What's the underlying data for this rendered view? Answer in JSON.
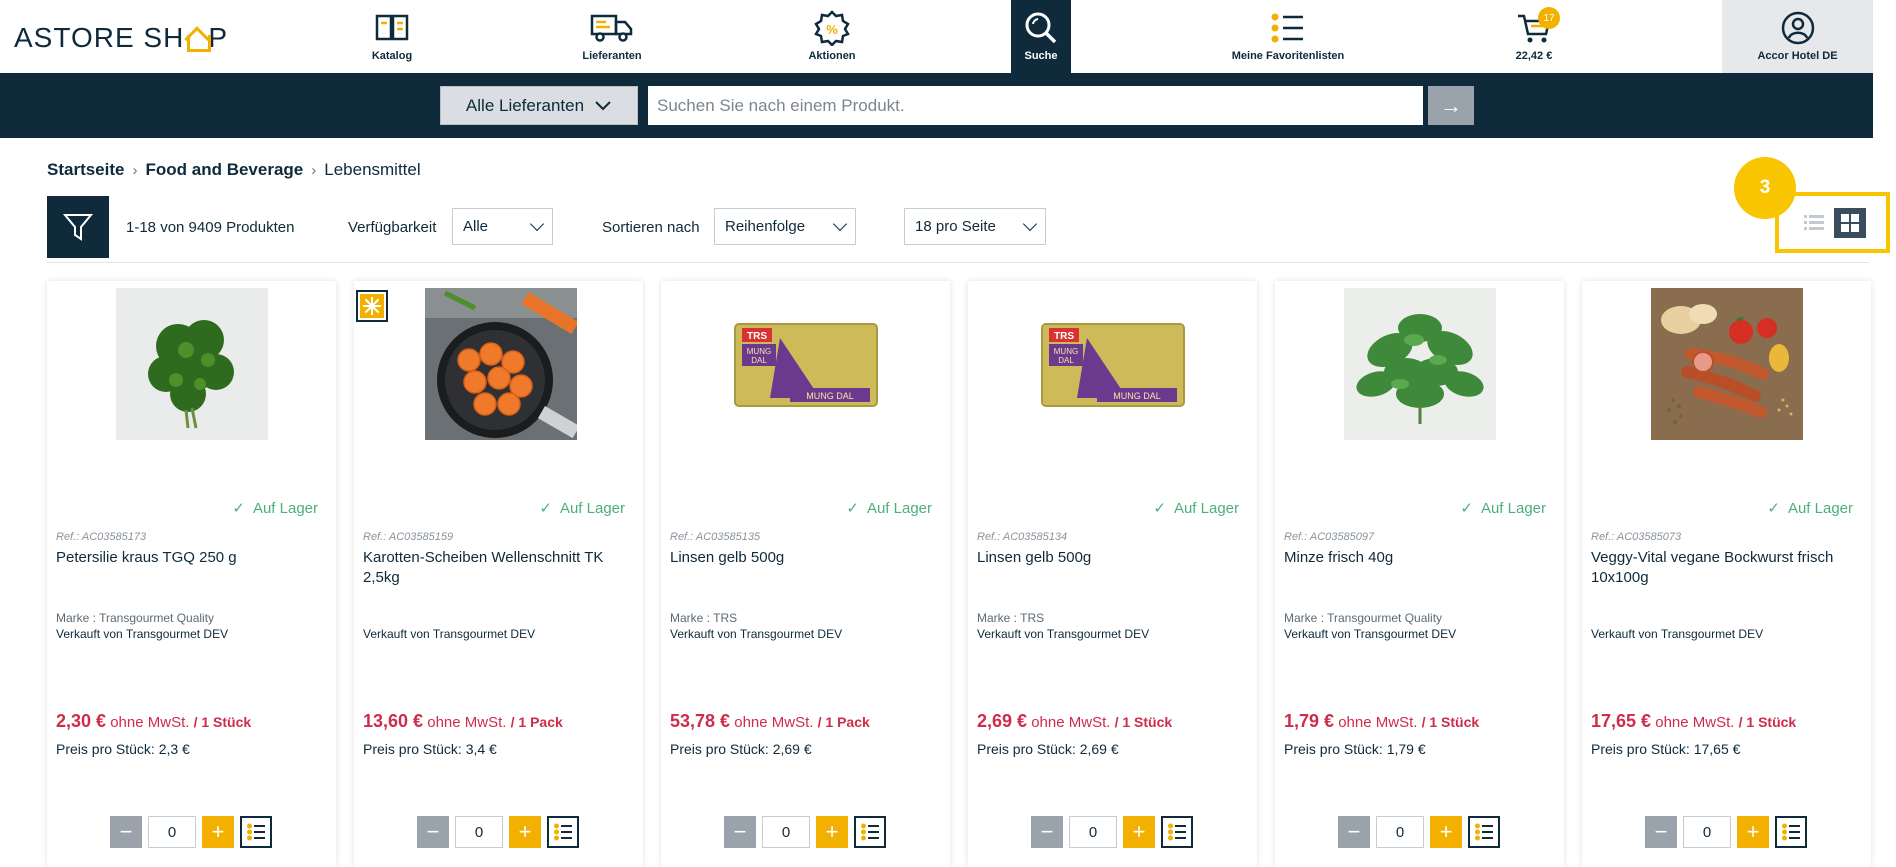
{
  "brand": {
    "logo_text_a": "ASTORE SH",
    "logo_text_b": "P"
  },
  "nav": {
    "katalog": "Katalog",
    "lieferanten": "Lieferanten",
    "aktionen": "Aktionen",
    "suche": "Suche",
    "favoriten": "Meine Favoritenlisten",
    "cart_total": "22,42 €",
    "cart_count": "17",
    "account": "Accor Hotel DE"
  },
  "search": {
    "supplier": "Alle Lieferanten",
    "placeholder": "Suchen Sie nach einem Produkt.",
    "go": "→"
  },
  "breadcrumb": {
    "home": "Startseite",
    "category": "Food and Beverage",
    "current": "Lebensmittel"
  },
  "toolbar": {
    "count": "1-18 von 9409 Produkten",
    "availability_label": "Verfügbarkeit",
    "availability_value": "Alle",
    "sort_label": "Sortieren nach",
    "sort_value": "Reihenfolge",
    "per_page": "18 pro Seite",
    "step_number": "3"
  },
  "colors": {
    "navy": "#0e2a3b",
    "accent_yellow": "#f2b100",
    "price_red": "#cf2c4a",
    "stock_green": "#4caf7d"
  },
  "products": [
    {
      "stock": "Auf Lager",
      "ref": "Ref.: AC03585173",
      "name": "Petersilie kraus TGQ 250 g",
      "brand": "Marke : Transgourmet Quality",
      "seller": "Verkauft von Transgourmet DEV",
      "price": "2,30 €",
      "tax": " ohne MwSt. ",
      "unit": "/ 1 Stück",
      "unit_price": "Preis pro Stück: 2,3 €",
      "qty": "0"
    },
    {
      "stock": "Auf Lager",
      "ref": "Ref.: AC03585159",
      "name": "Karotten-Scheiben Wellenschnitt TK 2,5kg",
      "brand": "",
      "seller": "Verkauft von Transgourmet DEV",
      "price": "13,60 €",
      "tax": " ohne MwSt. ",
      "unit": "/ 1 Pack",
      "unit_price": "Preis pro Stück: 3,4 €",
      "qty": "0"
    },
    {
      "stock": "Auf Lager",
      "ref": "Ref.: AC03585135",
      "name": "Linsen gelb 500g",
      "brand": "Marke : TRS",
      "seller": "Verkauft von Transgourmet DEV",
      "price": "53,78 €",
      "tax": " ohne MwSt. ",
      "unit": "/ 1 Pack",
      "unit_price": "Preis pro Stück: 2,69 €",
      "qty": "0"
    },
    {
      "stock": "Auf Lager",
      "ref": "Ref.: AC03585134",
      "name": "Linsen gelb 500g",
      "brand": "Marke : TRS",
      "seller": "Verkauft von Transgourmet DEV",
      "price": "2,69 €",
      "tax": " ohne MwSt. ",
      "unit": "/ 1 Stück",
      "unit_price": "Preis pro Stück: 2,69 €",
      "qty": "0"
    },
    {
      "stock": "Auf Lager",
      "ref": "Ref.: AC03585097",
      "name": "Minze frisch 40g",
      "brand": "Marke : Transgourmet Quality",
      "seller": "Verkauft von Transgourmet DEV",
      "price": "1,79 €",
      "tax": " ohne MwSt. ",
      "unit": "/ 1 Stück",
      "unit_price": "Preis pro Stück: 1,79 €",
      "qty": "0"
    },
    {
      "stock": "Auf Lager",
      "ref": "Ref.: AC03585073",
      "name": "Veggy-Vital vegane Bockwurst frisch 10x100g",
      "brand": "",
      "seller": "Verkauft von Transgourmet DEV",
      "price": "17,65 €",
      "tax": " ohne MwSt. ",
      "unit": "/ 1 Stück",
      "unit_price": "Preis pro Stück: 17,65 €",
      "qty": "0"
    }
  ]
}
